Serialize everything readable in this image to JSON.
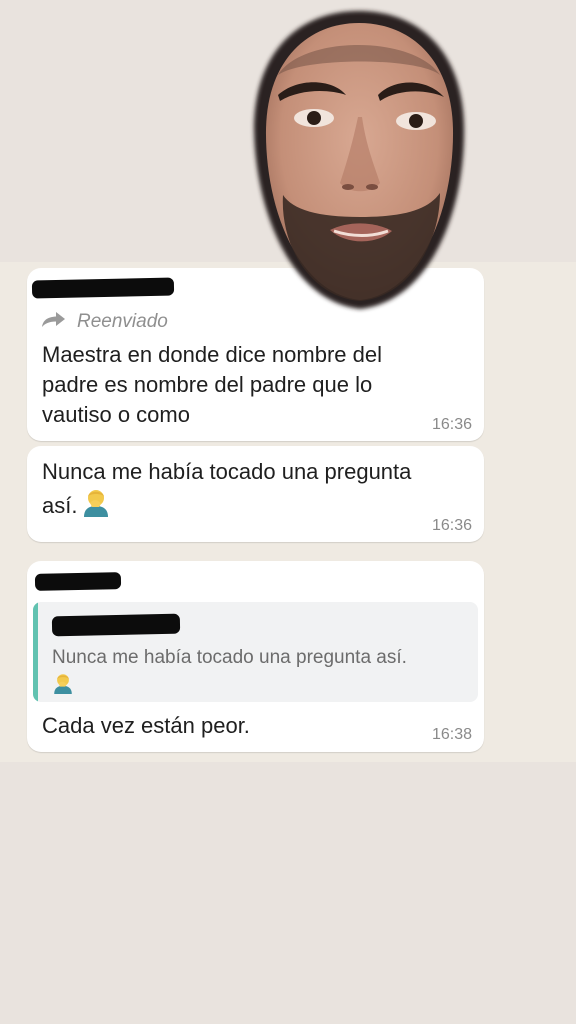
{
  "colors": {
    "background": "#e9e3de",
    "bubble": "#ffffff",
    "quote_bar": "#61c2b0",
    "quote_background": "#f1f2f3",
    "meta_text": "#8a8a8a"
  },
  "overlay": {
    "icon": "man-face-icon"
  },
  "messages": [
    {
      "forwarded_label": "Reenviado",
      "forward_icon": "forward-arrow-icon",
      "lines": [
        "Maestra en donde dice nombre del",
        "padre es nombre del padre que lo",
        "vautiso o como"
      ],
      "time": "16:36"
    },
    {
      "lines": [
        "Nunca me había tocado una pregunta",
        "así."
      ],
      "emoji": "person-facepalming-icon",
      "time": "16:36"
    },
    {
      "quote_text": "Nunca me había tocado una pregunta así.",
      "quote_emoji": "person-facepalming-icon",
      "text": "Cada vez están peor.",
      "time": "16:38"
    }
  ]
}
